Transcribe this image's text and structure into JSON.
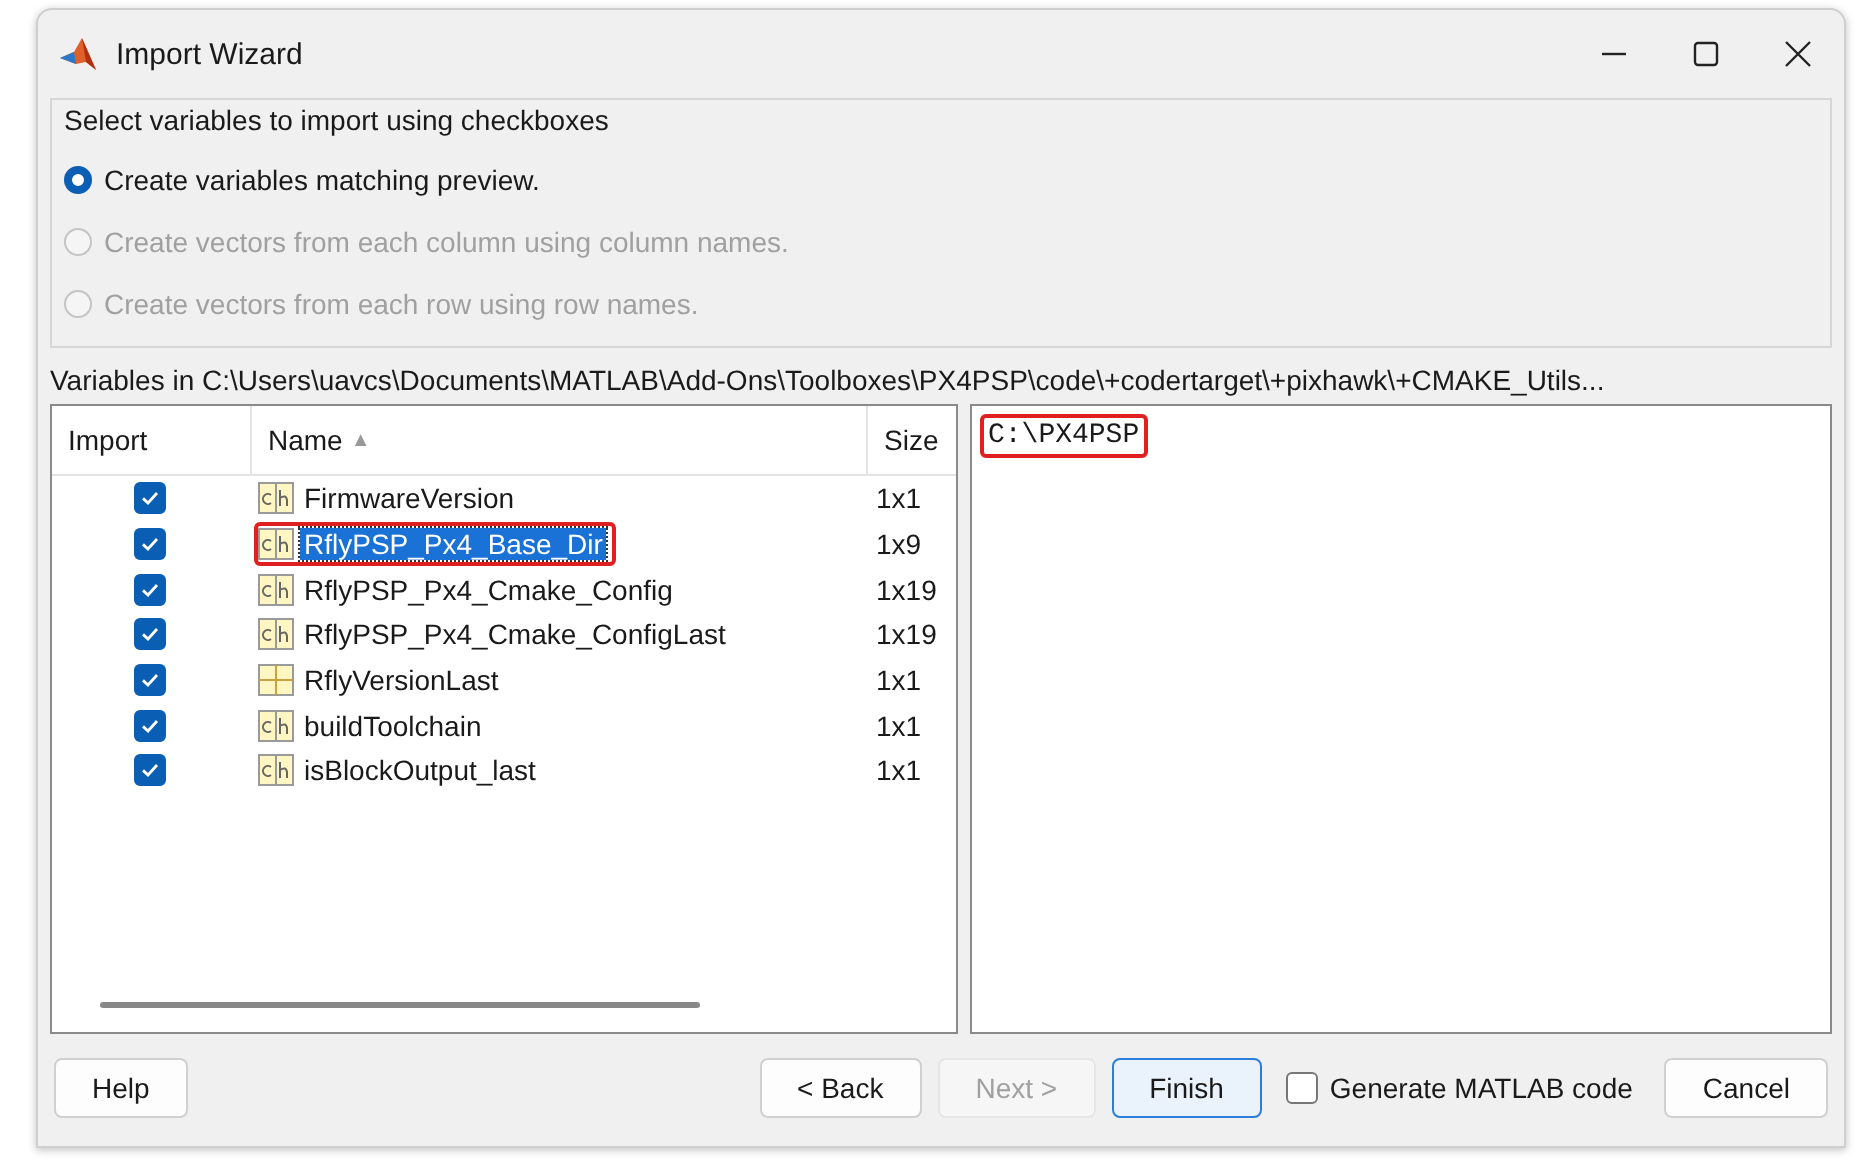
{
  "window": {
    "title": "Import Wizard"
  },
  "options": {
    "title": "Select variables to import using checkboxes",
    "radios": [
      {
        "label": "Create variables matching preview.",
        "selected": true,
        "disabled": false
      },
      {
        "label": "Create vectors from each column using column names.",
        "selected": false,
        "disabled": true
      },
      {
        "label": "Create vectors from each row using row names.",
        "selected": false,
        "disabled": true
      }
    ]
  },
  "variables_label": "Variables in C:\\Users\\uavcs\\Documents\\MATLAB\\Add-Ons\\Toolboxes\\PX4PSP\\code\\+codertarget\\+pixhawk\\+CMAKE_Utils...",
  "table": {
    "columns": [
      "Import",
      "Name",
      "Size"
    ],
    "sort_indicator": "▲",
    "rows": [
      {
        "checked": true,
        "kind": "char",
        "name": "FirmwareVersion",
        "size": "1x1",
        "selected": false,
        "highlighted": false
      },
      {
        "checked": true,
        "kind": "char",
        "name": "RflyPSP_Px4_Base_Dir",
        "size": "1x9",
        "selected": true,
        "highlighted": true
      },
      {
        "checked": true,
        "kind": "char",
        "name": "RflyPSP_Px4_Cmake_Config",
        "size": "1x19",
        "selected": false,
        "highlighted": false
      },
      {
        "checked": true,
        "kind": "char",
        "name": "RflyPSP_Px4_Cmake_ConfigLast",
        "size": "1x19",
        "selected": false,
        "highlighted": false
      },
      {
        "checked": true,
        "kind": "cell",
        "name": "RflyVersionLast",
        "size": "1x1",
        "selected": false,
        "highlighted": false
      },
      {
        "checked": true,
        "kind": "char",
        "name": "buildToolchain",
        "size": "1x1",
        "selected": false,
        "highlighted": false
      },
      {
        "checked": true,
        "kind": "char",
        "name": "isBlockOutput_last",
        "size": "1x1",
        "selected": false,
        "highlighted": false
      }
    ]
  },
  "preview": {
    "text": "C:\\PX4PSP",
    "highlighted": true
  },
  "buttons": [
    {
      "label": "Help",
      "disabled": false,
      "focused": false
    },
    {
      "label": "< Back",
      "disabled": false,
      "focused": false
    },
    {
      "label": "Next >",
      "disabled": true,
      "focused": false
    },
    {
      "label": "Finish",
      "disabled": false,
      "focused": true
    }
  ],
  "generate_code": {
    "label": "Generate MATLAB code",
    "checked": false
  },
  "cancel_button": {
    "label": "Cancel",
    "disabled": false,
    "focused": false
  }
}
